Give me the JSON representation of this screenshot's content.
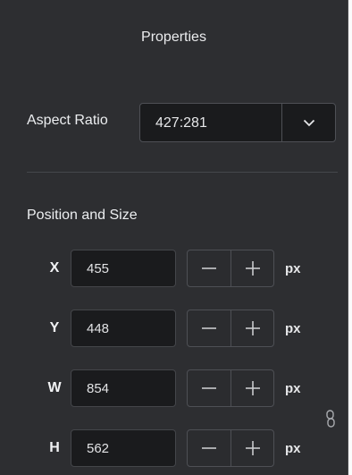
{
  "panel": {
    "title": "Properties"
  },
  "aspect_ratio": {
    "label": "Aspect Ratio",
    "value": "427:281",
    "dropdown_icon": "chevron-down-icon"
  },
  "position_size": {
    "label": "Position and Size",
    "unit": "px",
    "decrement_icon": "minus-icon",
    "increment_icon": "plus-icon",
    "lock_icon": "link-icon",
    "fields": [
      {
        "label": "X",
        "value": "455"
      },
      {
        "label": "Y",
        "value": "448"
      },
      {
        "label": "W",
        "value": "854"
      },
      {
        "label": "H",
        "value": "562"
      }
    ]
  },
  "colors": {
    "panel_background": "#2d2e31",
    "input_background": "#1a1b1d",
    "border": "#4e5055",
    "text": "#e7e8ea"
  }
}
